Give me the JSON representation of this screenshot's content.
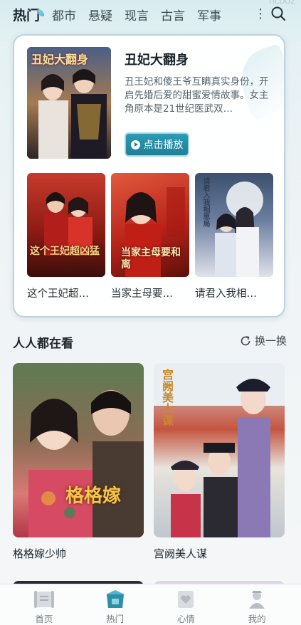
{
  "top_tabs": [
    {
      "label": "热门",
      "active": true
    },
    {
      "label": "都市",
      "active": false
    },
    {
      "label": "悬疑",
      "active": false
    },
    {
      "label": "现言",
      "active": false
    },
    {
      "label": "古言",
      "active": false
    },
    {
      "label": "军事",
      "active": false
    }
  ],
  "more_label": "⋮",
  "corner_mark": "TICDOZ",
  "featured": {
    "title": "丑妃大翻身",
    "description": "丑王妃和傻王爷互瞒真实身份，开启先婚后爱的甜蜜爱情故事。女主角原本是21世纪医武双…",
    "play_label": "点击播放",
    "poster_text": "丑妃大翻身"
  },
  "recommendations": [
    {
      "title": "这个王妃超…",
      "poster_text": "这个王妃超凶猛"
    },
    {
      "title": "当家主母要…",
      "poster_text": "当家主母要和离"
    },
    {
      "title": "请君入我相…",
      "poster_text": "请君入我相思局"
    }
  ],
  "section": {
    "title": "人人都在看",
    "refresh_label": "换一换"
  },
  "popular": [
    {
      "title": "格格嫁少帅",
      "poster_text": "格格嫁"
    },
    {
      "title": "宫阙美人谋",
      "poster_text": "宫阙美人谋"
    }
  ],
  "bottom_nav": [
    {
      "label": "首页",
      "icon": "scroll-icon",
      "active": false
    },
    {
      "label": "热门",
      "icon": "hot-box-icon",
      "active": true
    },
    {
      "label": "心情",
      "icon": "heart-card-icon",
      "active": false
    },
    {
      "label": "我的",
      "icon": "person-icon",
      "active": false
    }
  ],
  "colors": {
    "accent": "#1f7f98",
    "tab_active": "#1b2530",
    "background_top": "#d7ecef"
  }
}
